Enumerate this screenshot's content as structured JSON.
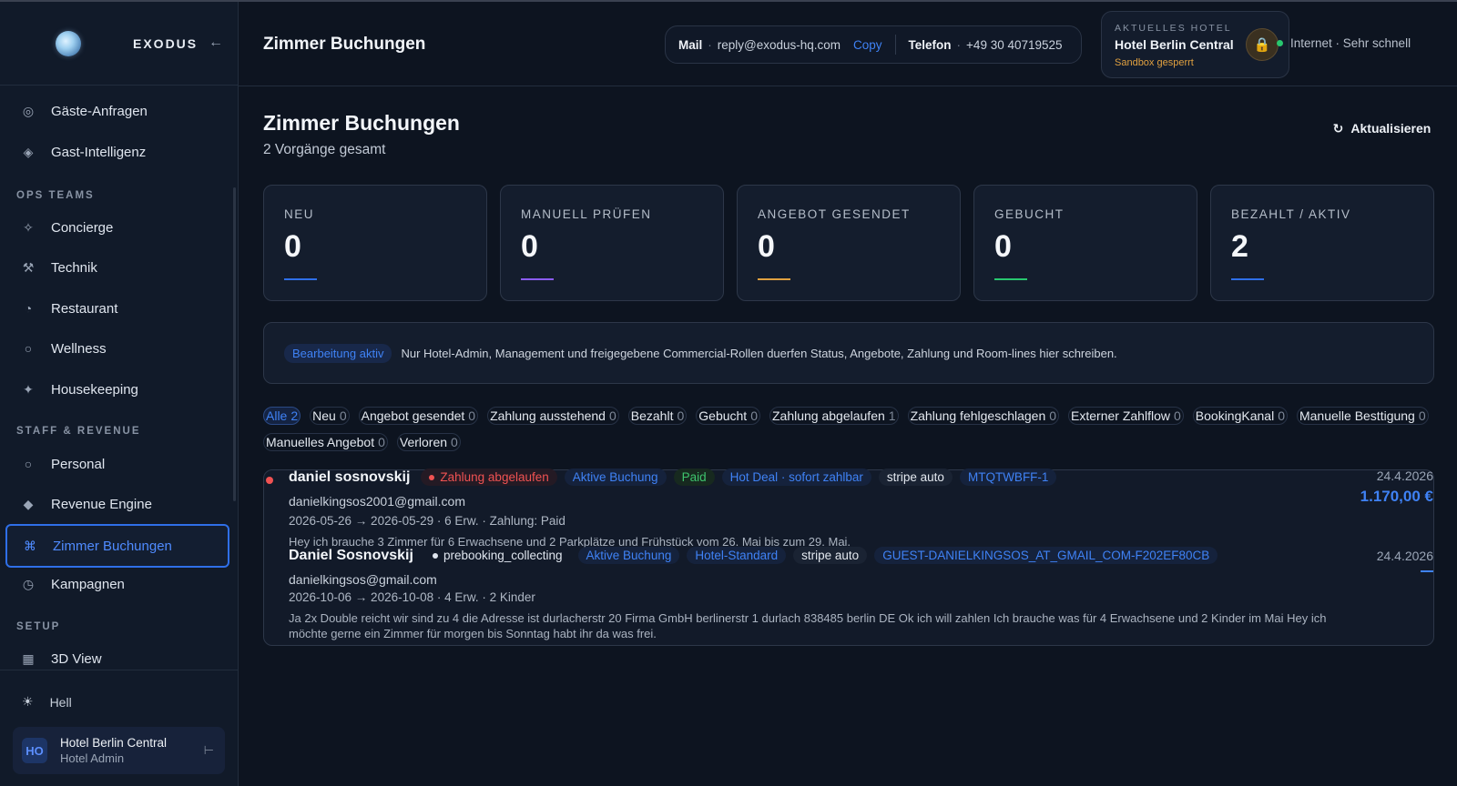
{
  "app": {
    "brand": "EXODUS"
  },
  "sidebar": {
    "items_top": [
      {
        "label": "Gäste-Anfragen",
        "icon": "circle-dotted-icon"
      },
      {
        "label": "Gast-Intelligenz",
        "icon": "diamond-icon"
      }
    ],
    "section_ops": "OPS TEAMS",
    "items_ops": [
      {
        "label": "Concierge",
        "icon": "sparkle-icon"
      },
      {
        "label": "Technik",
        "icon": "wrench-icon"
      },
      {
        "label": "Restaurant",
        "icon": "pie-icon"
      },
      {
        "label": "Wellness",
        "icon": "circle-icon"
      },
      {
        "label": "Housekeeping",
        "icon": "star-icon"
      }
    ],
    "section_staff": "STAFF & REVENUE",
    "items_staff": [
      {
        "label": "Personal",
        "icon": "circle-icon"
      },
      {
        "label": "Revenue Engine",
        "icon": "diamond-icon"
      },
      {
        "label": "Zimmer Buchungen",
        "icon": "command-icon",
        "active": true
      },
      {
        "label": "Kampagnen",
        "icon": "clock-icon"
      }
    ],
    "section_setup": "SETUP",
    "items_setup": [
      {
        "label": "3D View",
        "icon": "grid-icon"
      }
    ],
    "theme_label": "Hell",
    "user": {
      "initials": "HO",
      "name": "Hotel Berlin Central",
      "role": "Hotel Admin"
    }
  },
  "header": {
    "title": "Zimmer Buchungen",
    "mail_label": "Mail",
    "mail_value": "reply@exodus-hq.com",
    "copy_label": "Copy",
    "phone_label": "Telefon",
    "phone_value": "+49 30 40719525",
    "hotel_caption": "AKTUELLES HOTEL",
    "hotel_name": "Hotel Berlin Central",
    "hotel_status": "Sandbox gesperrt",
    "network": "Internet · Sehr schnell"
  },
  "main": {
    "title": "Zimmer Buchungen",
    "subtitle": "2 Vorgänge gesamt",
    "refresh_label": "Aktualisieren",
    "stats": [
      {
        "label": "NEU",
        "value": "0",
        "color": "#2f6fe8"
      },
      {
        "label": "MANUELL PRÜFEN",
        "value": "0",
        "color": "#8b5cf6"
      },
      {
        "label": "ANGEBOT GESENDET",
        "value": "0",
        "color": "#e0a040"
      },
      {
        "label": "GEBUCHT",
        "value": "0",
        "color": "#28c76f"
      },
      {
        "label": "BEZAHLT / AKTIV",
        "value": "2",
        "color": "#2f6fe8"
      }
    ],
    "notice_badge": "Bearbeitung aktiv",
    "notice_text": "Nur Hotel-Admin, Management und freigegebene Commercial-Rollen duerfen Status, Angebote, Zahlung und Room-lines hier schreiben.",
    "filters_row1": [
      {
        "label": "Alle",
        "count": "2",
        "active": true
      },
      {
        "label": "Neu",
        "count": "0"
      },
      {
        "label": "Angebot gesendet",
        "count": "0"
      },
      {
        "label": "Zahlung ausstehend",
        "count": "0"
      },
      {
        "label": "Bezahlt",
        "count": "0"
      },
      {
        "label": "Gebucht",
        "count": "0"
      },
      {
        "label": "Zahlung abgelaufen",
        "count": "1"
      },
      {
        "label": "Zahlung fehlgeschlagen",
        "count": "0"
      },
      {
        "label": "Externer Zahlflow",
        "count": "0"
      },
      {
        "label": "BookingKanal",
        "count": "0"
      },
      {
        "label": "Manuelle Besttigung",
        "count": "0"
      }
    ],
    "filters_row2": [
      {
        "label": "Manuelles Angebot",
        "count": "0"
      },
      {
        "label": "Verloren",
        "count": "0"
      }
    ],
    "bookings": [
      {
        "name": "daniel sosnovskij",
        "status": "Zahlung abgelaufen",
        "tags": [
          "Aktive Buchung",
          "Paid",
          "Hot Deal · sofort zahlbar",
          "stripe auto",
          "MTQTWBFF-1"
        ],
        "email": "danielkingsos2001@gmail.com",
        "details": "2026-05-26 → 2026-05-29 · 6 Erw. · Zahlung: Paid",
        "message": "Hey ich brauche 3 Zimmer für 6 Erwachsene und 2 Parkplätze und Frühstück vom 26. Mai bis zum 29. Mai.",
        "date": "24.4.2026",
        "amount": "1.170,00 €"
      },
      {
        "name": "Daniel Sosnovskij",
        "status": "prebooking_collecting",
        "tags": [
          "Aktive Buchung",
          "Hotel-Standard",
          "stripe auto",
          "GUEST-DANIELKINGSOS_AT_GMAIL_COM-F202EF80CB"
        ],
        "email": "danielkingsos@gmail.com",
        "details": "2026-10-06 → 2026-10-08 · 4 Erw. · 2 Kinder",
        "message": "Ja 2x Double reicht wir sind zu 4 die Adresse ist durlacherstr 20 Firma GmbH berlinerstr 1 durlach 838485 berlin DE Ok ich will zahlen Ich brauche was für 4 Erwachsene und 2 Kinder im Mai Hey ich möchte gerne ein Zimmer für morgen bis Sonntag habt ihr da was frei.",
        "date": "24.4.2026"
      }
    ]
  }
}
